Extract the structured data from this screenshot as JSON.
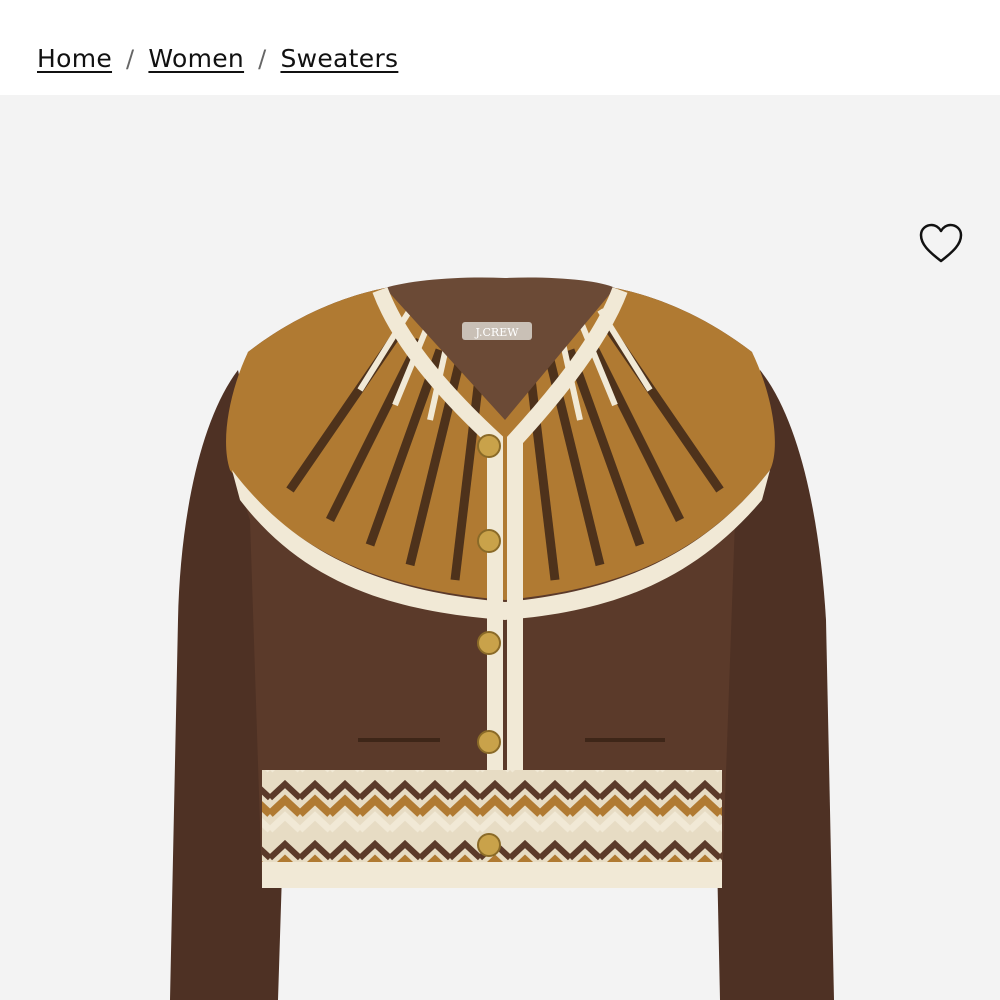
{
  "breadcrumb": {
    "items": [
      {
        "label": "Home"
      },
      {
        "label": "Women"
      },
      {
        "label": "Sweaters"
      }
    ],
    "separator": "/"
  },
  "product_image": {
    "brand_tag": "J.CREW",
    "alt_subject": "cardigan",
    "colors": {
      "background": "#f3f3f3",
      "body": "#5b3a2a",
      "yoke_gold": "#b07a32",
      "cream": "#f1e9d6",
      "button_gold": "#c9a24a"
    }
  },
  "wishlist": {
    "icon": "heart-outline-icon"
  }
}
